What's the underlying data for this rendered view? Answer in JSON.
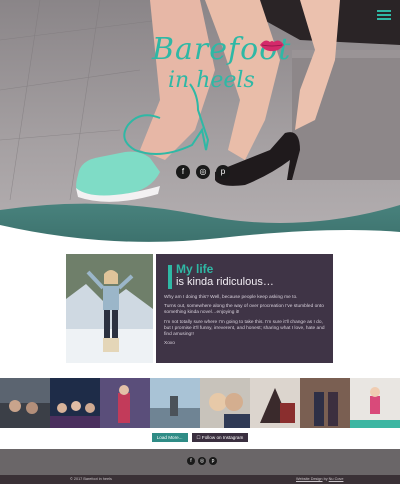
{
  "hero": {
    "logo_line1": "Barefoot",
    "logo_line2": "in heels",
    "social": [
      {
        "icon": "facebook-icon",
        "glyph": "f"
      },
      {
        "icon": "instagram-icon",
        "glyph": "◎"
      },
      {
        "icon": "pinterest-icon",
        "glyph": "p"
      }
    ]
  },
  "about": {
    "title": "My life",
    "subtitle": "is kinda ridiculous…",
    "paragraphs": [
      "Why am I doing this? Well, because people keep asking me to.",
      "Turns out, somewhere along the way of over procreation I've stumbled onto something kinda novel…enjoying it!",
      "I'm not totally sure where I'm going to take this. I'm sure it'll change as I do, but I promise it'll funny, irreverent, and honest; sharing what I love, hate and find amusing!!",
      "Xoxo"
    ]
  },
  "buttons": {
    "load_more": "Load More...",
    "follow": "☐ Follow on Instagram"
  },
  "footer": {
    "copyright": "© 2017 Barefoot in heels",
    "credits_prefix": "Website Design",
    "credits_by": "by",
    "credits_link": "Nu Cove",
    "social": [
      {
        "icon": "facebook-icon",
        "glyph": "f"
      },
      {
        "icon": "instagram-icon",
        "glyph": "◎"
      },
      {
        "icon": "pinterest-icon",
        "glyph": "p"
      }
    ]
  },
  "colors": {
    "accent": "#2fb8a5",
    "panel": "#3f3446",
    "lips": "#d42a6a",
    "footer_band": "#6a6668",
    "footer_bar": "#3a3136"
  }
}
